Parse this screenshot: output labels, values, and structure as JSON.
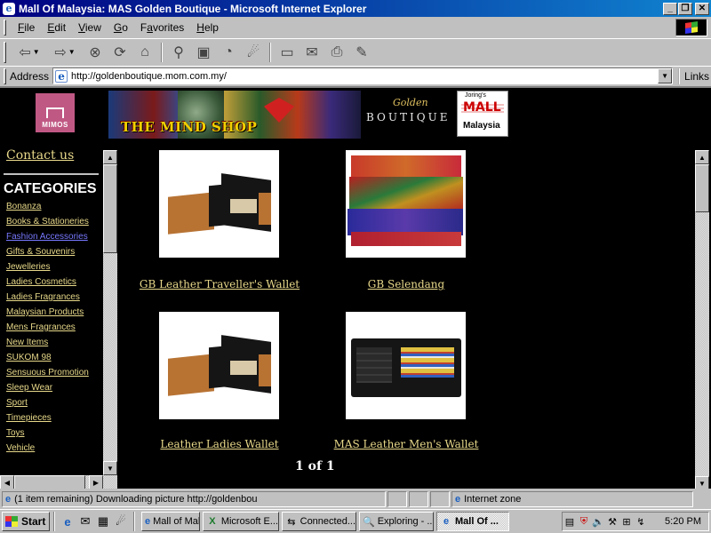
{
  "window": {
    "title": "Mall Of Malaysia: MAS Golden Boutique - Microsoft Internet Explorer",
    "minimize": "_",
    "maximize": "❐",
    "close": "✕"
  },
  "menu": [
    "File",
    "Edit",
    "View",
    "Go",
    "Favorites",
    "Help"
  ],
  "menu_accel": [
    "F",
    "E",
    "V",
    "G",
    "a",
    "H"
  ],
  "address": {
    "label": "Address",
    "url": "http://goldenboutique.mom.com.my/",
    "links_label": "Links"
  },
  "banner": {
    "mimos": "MIMOS",
    "mindshop": "THE MIND SHOP",
    "golden": "Golden",
    "boutique": "BOUTIQUE",
    "mall_small": "Joring's",
    "mall": "MALL",
    "malaysia": "Malaysia"
  },
  "sidebar": {
    "contact": "Contact us",
    "categories_title": "CATEGORIES",
    "categories": [
      {
        "label": "Bonanza",
        "visited": false
      },
      {
        "label": "Books & Stationeries",
        "visited": false
      },
      {
        "label": "Fashion Accessories",
        "visited": true
      },
      {
        "label": "Gifts & Souvenirs",
        "visited": false
      },
      {
        "label": "Jewelleries",
        "visited": false
      },
      {
        "label": "Ladies Cosmetics",
        "visited": false
      },
      {
        "label": "Ladies Fragrances",
        "visited": false
      },
      {
        "label": "Malaysian Products",
        "visited": false
      },
      {
        "label": "Mens Fragrances",
        "visited": false
      },
      {
        "label": "New Items",
        "visited": false
      },
      {
        "label": "SUKOM 98",
        "visited": false
      },
      {
        "label": "Sensuous Promotion",
        "visited": false
      },
      {
        "label": "Sleep Wear",
        "visited": false
      },
      {
        "label": "Sport",
        "visited": false
      },
      {
        "label": "Timepieces",
        "visited": false
      },
      {
        "label": "Toys",
        "visited": false
      },
      {
        "label": "Vehicle",
        "visited": false
      }
    ]
  },
  "products": [
    {
      "name": "GB Leather Traveller's Wallet"
    },
    {
      "name": "GB Selendang"
    },
    {
      "name": "Leather Ladies Wallet"
    },
    {
      "name": "MAS Leather Men's Wallet"
    }
  ],
  "pager": "1 of 1",
  "status": {
    "message": "(1 item remaining) Downloading picture http://goldenbou",
    "zone": "Internet zone"
  },
  "taskbar": {
    "start": "Start",
    "tasks": [
      {
        "label": "Mall of Mal...",
        "active": false
      },
      {
        "label": "Microsoft E...",
        "active": false
      },
      {
        "label": "Connected...",
        "active": false
      },
      {
        "label": "Exploring - ...",
        "active": false
      },
      {
        "label": "Mall Of ...",
        "active": true
      }
    ],
    "clock": "5:20 PM"
  },
  "colors": {
    "link": "#e8d98a",
    "visited_link": "#7878ff",
    "titlebar_start": "#000080",
    "titlebar_end": "#1084d0",
    "page_bg": "#000000"
  }
}
